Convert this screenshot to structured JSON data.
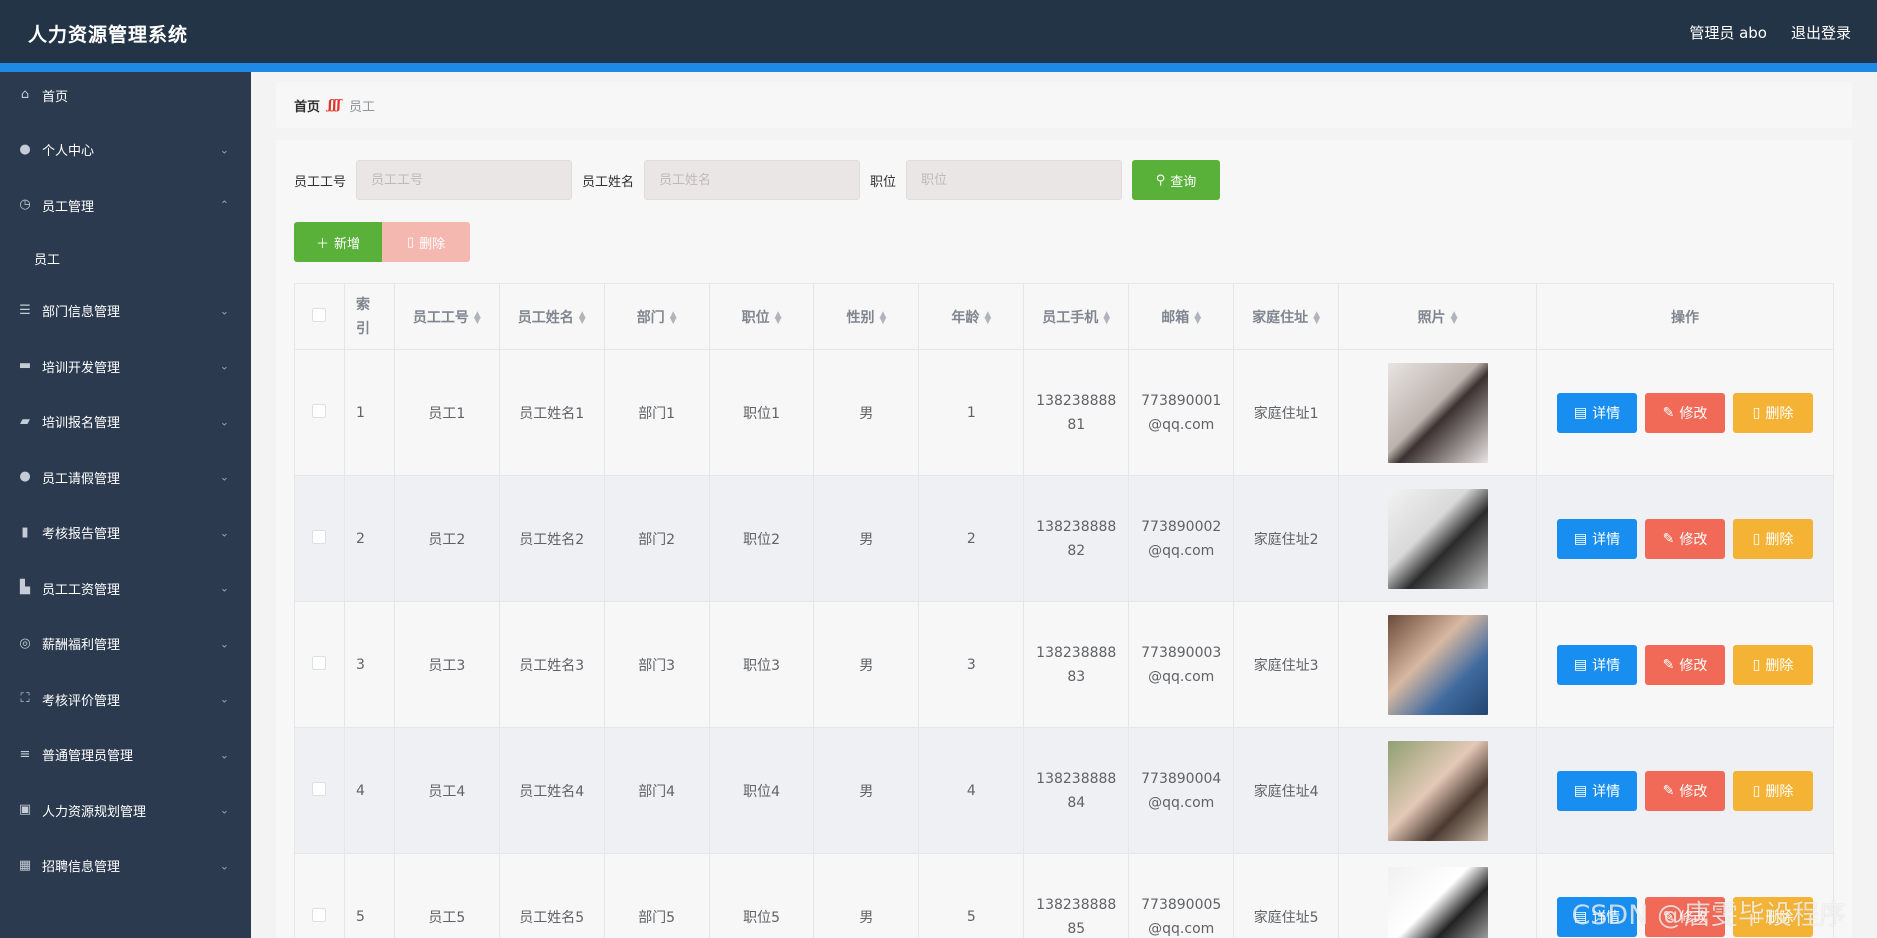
{
  "app": {
    "title": "人力资源管理系统"
  },
  "header": {
    "user": "管理员 abo",
    "logout": "退出登录"
  },
  "sidebar": {
    "items": [
      {
        "label": "首页",
        "icon": "home-icon",
        "expandable": false
      },
      {
        "label": "个人中心",
        "icon": "user-icon",
        "expandable": true
      },
      {
        "label": "员工管理",
        "icon": "clock-icon",
        "expandable": true,
        "expanded": true,
        "children": [
          {
            "label": "员工"
          }
        ]
      },
      {
        "label": "部门信息管理",
        "icon": "sliders-icon",
        "expandable": true
      },
      {
        "label": "培训开发管理",
        "icon": "chat-icon",
        "expandable": true
      },
      {
        "label": "培训报名管理",
        "icon": "ticket-icon",
        "expandable": true
      },
      {
        "label": "员工请假管理",
        "icon": "user-icon",
        "expandable": true
      },
      {
        "label": "考核报告管理",
        "icon": "bar-chart-icon",
        "expandable": true
      },
      {
        "label": "员工工资管理",
        "icon": "stats-icon",
        "expandable": true
      },
      {
        "label": "薪酬福利管理",
        "icon": "target-icon",
        "expandable": true
      },
      {
        "label": "考核评价管理",
        "icon": "fullscreen-icon",
        "expandable": true
      },
      {
        "label": "普通管理员管理",
        "icon": "list-icon",
        "expandable": true
      },
      {
        "label": "人力资源规划管理",
        "icon": "clipboard-icon",
        "expandable": true
      },
      {
        "label": "招聘信息管理",
        "icon": "grid-icon",
        "expandable": true
      }
    ]
  },
  "breadcrumb": {
    "home": "首页",
    "current": "员工"
  },
  "search": {
    "fields": [
      {
        "label": "员工工号",
        "placeholder": "员工工号"
      },
      {
        "label": "员工姓名",
        "placeholder": "员工姓名"
      },
      {
        "label": "职位",
        "placeholder": "职位"
      }
    ],
    "query_label": "查询"
  },
  "actions": {
    "add_label": "新增",
    "delete_label": "删除"
  },
  "table": {
    "headers": [
      "索引",
      "员工工号",
      "员工姓名",
      "部门",
      "职位",
      "性别",
      "年龄",
      "员工手机",
      "邮箱",
      "家庭住址",
      "照片",
      "操作"
    ],
    "rows": [
      {
        "index": "1",
        "no": "员工1",
        "name": "员工姓名1",
        "dept": "部门1",
        "position": "职位1",
        "gender": "男",
        "age": "1",
        "phone_a": "138238888",
        "phone_b": "81",
        "email_a": "773890001",
        "email_b": "@qq.com",
        "address": "家庭住址1"
      },
      {
        "index": "2",
        "no": "员工2",
        "name": "员工姓名2",
        "dept": "部门2",
        "position": "职位2",
        "gender": "男",
        "age": "2",
        "phone_a": "138238888",
        "phone_b": "82",
        "email_a": "773890002",
        "email_b": "@qq.com",
        "address": "家庭住址2"
      },
      {
        "index": "3",
        "no": "员工3",
        "name": "员工姓名3",
        "dept": "部门3",
        "position": "职位3",
        "gender": "男",
        "age": "3",
        "phone_a": "138238888",
        "phone_b": "83",
        "email_a": "773890003",
        "email_b": "@qq.com",
        "address": "家庭住址3"
      },
      {
        "index": "4",
        "no": "员工4",
        "name": "员工姓名4",
        "dept": "部门4",
        "position": "职位4",
        "gender": "男",
        "age": "4",
        "phone_a": "138238888",
        "phone_b": "84",
        "email_a": "773890004",
        "email_b": "@qq.com",
        "address": "家庭住址4"
      },
      {
        "index": "5",
        "no": "员工5",
        "name": "员工姓名5",
        "dept": "部门5",
        "position": "职位5",
        "gender": "男",
        "age": "5",
        "phone_a": "138238888",
        "phone_b": "85",
        "email_a": "773890005",
        "email_b": "@qq.com",
        "address": "家庭住址5"
      }
    ],
    "ops": {
      "detail": "详情",
      "edit": "修改",
      "delete": "删除"
    }
  },
  "watermark": "CSDN @唐雯毕设程序",
  "colors": {
    "header_bg": "#243447",
    "sidebar_bg": "#2b3a4e",
    "accent": "#1f8ae6",
    "primary_green": "#59b13a",
    "detail_blue": "#188ff0",
    "edit_red": "#f06a57",
    "delete_yellow": "#f4b334"
  }
}
